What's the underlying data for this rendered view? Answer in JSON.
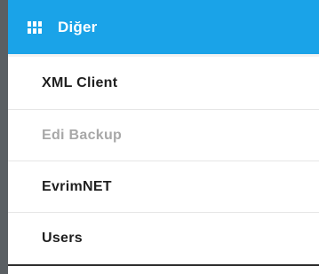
{
  "header": {
    "icon": "grid-icon",
    "title": "Diğer",
    "background": "#1aa3e8"
  },
  "menu": {
    "items": [
      {
        "label": "XML Client",
        "state": "enabled"
      },
      {
        "label": "Edi Backup",
        "state": "disabled"
      },
      {
        "label": "EvrimNET",
        "state": "enabled"
      },
      {
        "label": "Users",
        "state": "enabled"
      }
    ]
  }
}
